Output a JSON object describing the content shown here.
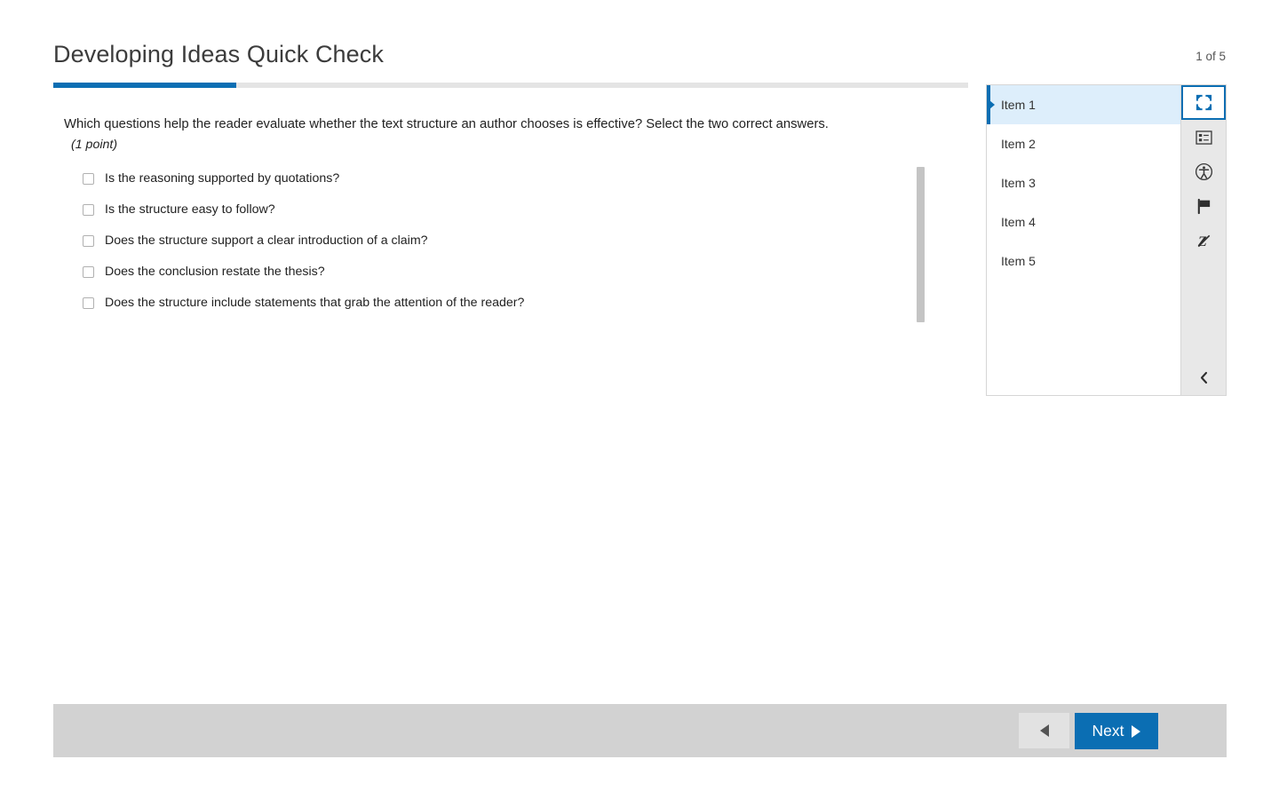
{
  "header": {
    "title": "Developing Ideas Quick Check",
    "counter": "1 of 5"
  },
  "progress": {
    "percent": 20
  },
  "question": {
    "stem": "Which questions help the reader evaluate whether the text structure an author chooses is effective? Select the two correct answers.",
    "points": "(1 point)",
    "options": [
      {
        "label": "Is the reasoning supported by quotations?",
        "checked": false
      },
      {
        "label": "Is the structure easy to follow?",
        "checked": false
      },
      {
        "label": "Does the structure support a clear introduction of a claim?",
        "checked": false
      },
      {
        "label": "Does the conclusion restate the thesis?",
        "checked": false
      },
      {
        "label": "Does the structure include statements that grab the attention of the reader?",
        "checked": false
      }
    ]
  },
  "side_panel": {
    "items": [
      {
        "label": "Item 1",
        "selected": true
      },
      {
        "label": "Item 2",
        "selected": false
      },
      {
        "label": "Item 3",
        "selected": false
      },
      {
        "label": "Item 4",
        "selected": false
      },
      {
        "label": "Item 5",
        "selected": false
      }
    ]
  },
  "icon_rail": {
    "buttons": [
      {
        "name": "fullscreen-icon",
        "active": true
      },
      {
        "name": "item-summary-icon",
        "active": false
      },
      {
        "name": "accessibility-icon",
        "active": false
      },
      {
        "name": "flag-icon",
        "active": false
      },
      {
        "name": "line-reader-off-icon",
        "active": false
      }
    ],
    "collapse": "collapse-panel-chevron-icon"
  },
  "footer": {
    "previous_label": "",
    "next_label": "Next"
  },
  "colors": {
    "accent": "#0b6eb3",
    "selected_row": "#ddeefb",
    "footer_bg": "#d2d2d2",
    "rail_bg": "#e8e8e8"
  }
}
